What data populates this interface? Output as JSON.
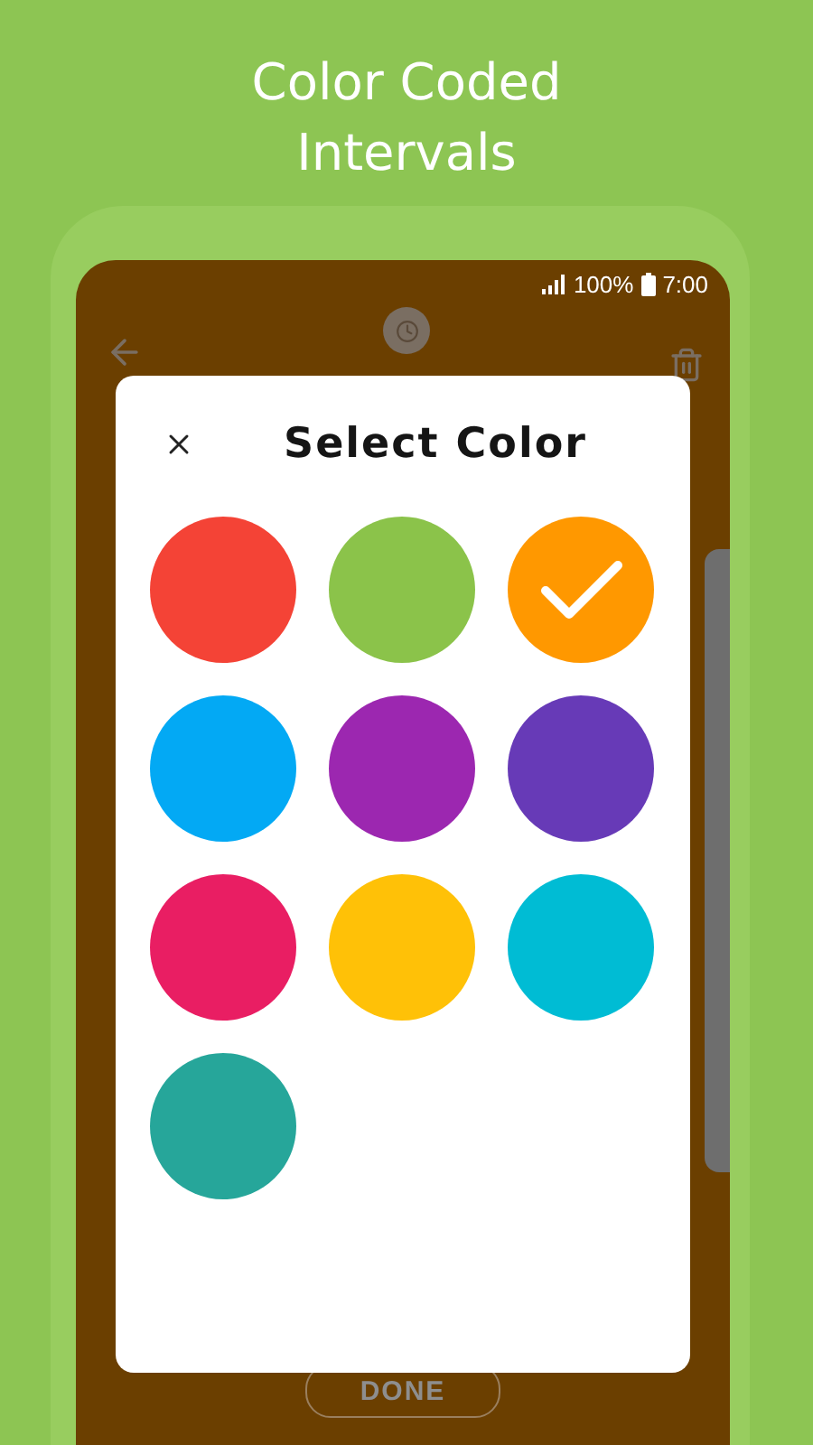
{
  "headline": "Color Coded Intervals",
  "status_bar": {
    "battery": "100%",
    "time": "7:00"
  },
  "dialog": {
    "title": "Select Color",
    "colors": [
      {
        "color": "#f44336",
        "selected": false
      },
      {
        "color": "#8bc34a",
        "selected": false
      },
      {
        "color": "#ff9800",
        "selected": true
      },
      {
        "color": "#03a9f4",
        "selected": false
      },
      {
        "color": "#9c27b0",
        "selected": false
      },
      {
        "color": "#673ab7",
        "selected": false
      },
      {
        "color": "#e91e63",
        "selected": false
      },
      {
        "color": "#ffc107",
        "selected": false
      },
      {
        "color": "#00bcd4",
        "selected": false
      },
      {
        "color": "#26a69a",
        "selected": false
      }
    ]
  },
  "done_button": "DONE"
}
